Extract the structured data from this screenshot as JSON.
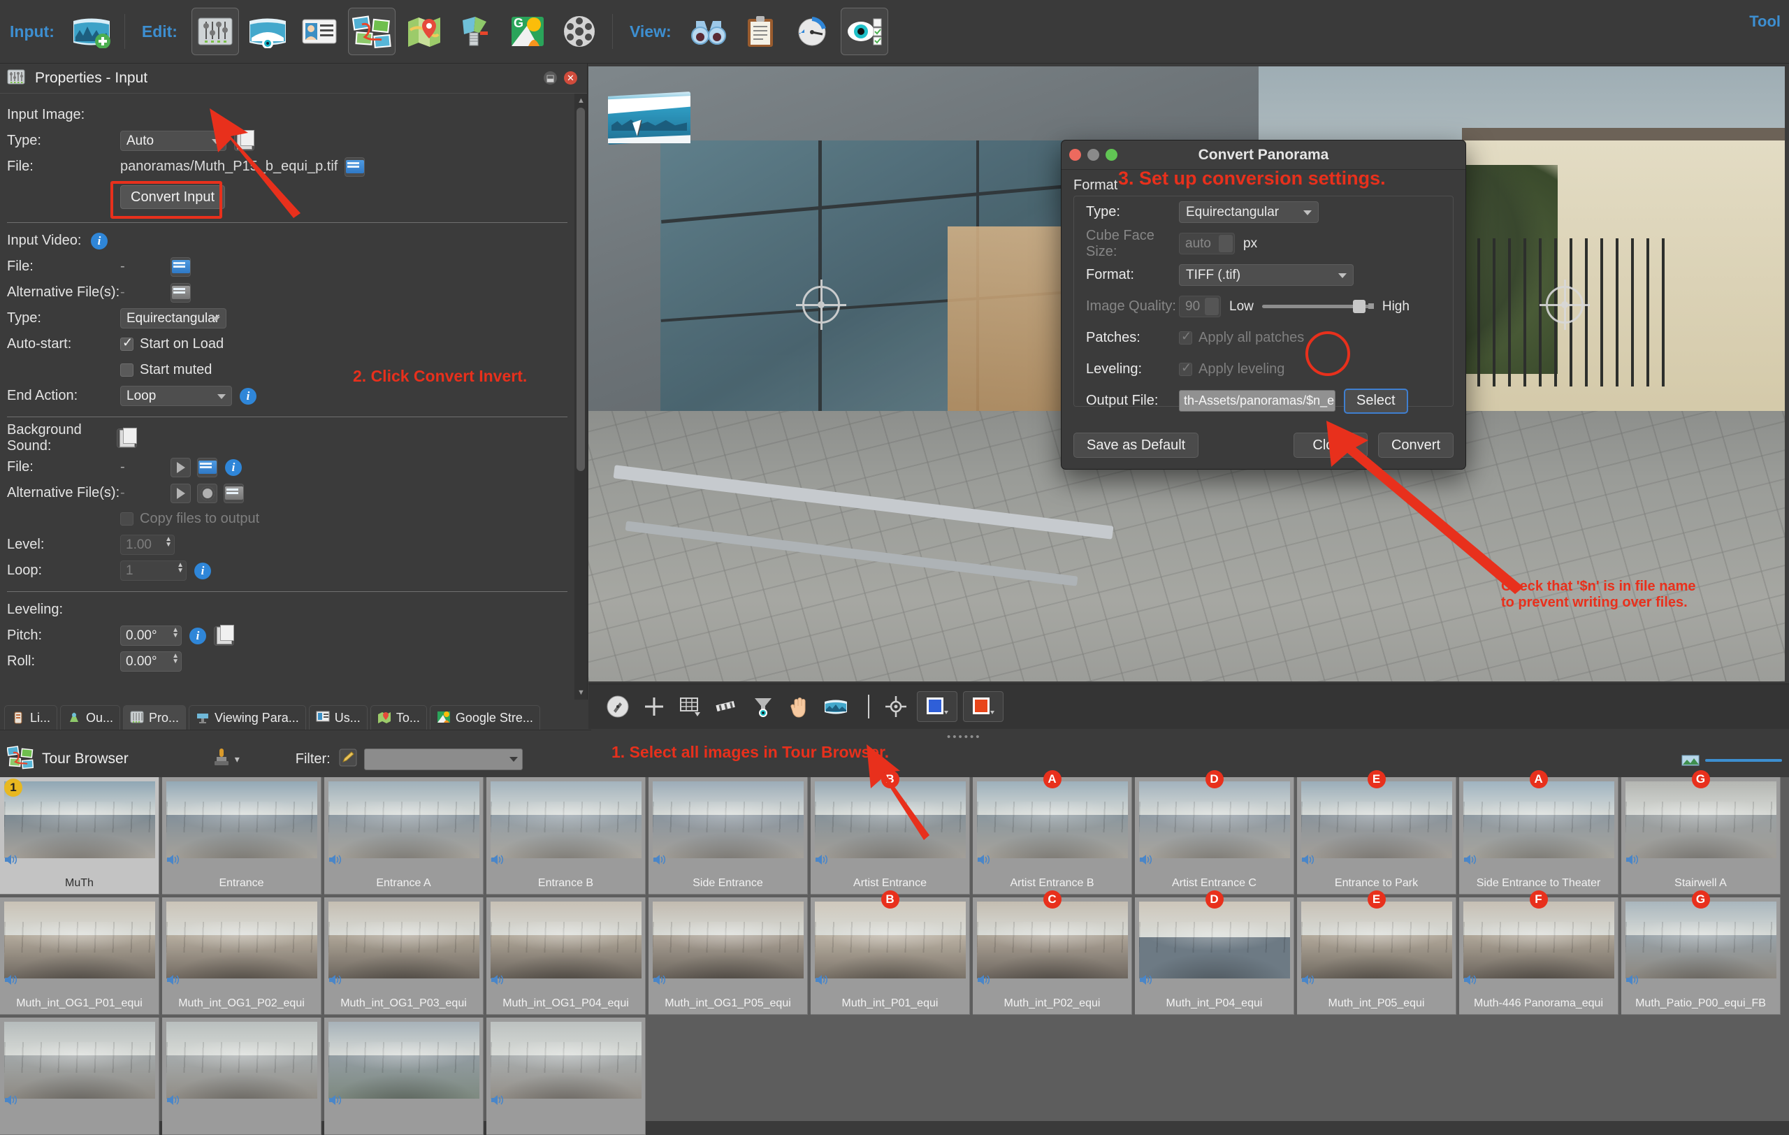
{
  "toolbar": {
    "input_label": "Input:",
    "edit_label": "Edit:",
    "view_label": "View:",
    "tools_label": "Tool",
    "input_items": [
      {
        "name": "add-panorama-icon"
      }
    ],
    "edit_items": [
      {
        "name": "properties-icon"
      },
      {
        "name": "panorama-editor-icon"
      },
      {
        "name": "user-data-icon"
      },
      {
        "name": "tour-editor-icon"
      },
      {
        "name": "map-editor-icon"
      },
      {
        "name": "model-editor-icon"
      },
      {
        "name": "google-street-view-icon"
      },
      {
        "name": "media-icon"
      }
    ],
    "view_items": [
      {
        "name": "binoculars-icon"
      },
      {
        "name": "clipboard-icon"
      },
      {
        "name": "compass-icon"
      },
      {
        "name": "visibility-icon"
      }
    ]
  },
  "properties": {
    "panel_title": "Properties - Input",
    "input_image_header": "Input Image:",
    "type_label": "Type:",
    "type_value": "Auto",
    "file_label": "File:",
    "file_value": "panoramas/Muth_P15_b_equi_p.tif",
    "convert_input_button": "Convert Input",
    "input_video_header": "Input Video:",
    "video_file_label": "File:",
    "video_file_value": "-",
    "video_alt_label": "Alternative File(s):",
    "video_alt_value": "-",
    "video_type_label": "Type:",
    "video_type_value": "Equirectangular",
    "autostart_label": "Auto-start:",
    "start_on_load_label": "Start on Load",
    "start_on_load_checked": true,
    "start_muted_label": "Start muted",
    "start_muted_checked": false,
    "end_action_label": "End Action:",
    "end_action_value": "Loop",
    "bg_sound_header": "Background Sound:",
    "bg_file_label": "File:",
    "bg_file_value": "-",
    "bg_alt_label": "Alternative File(s):",
    "bg_alt_value": "-",
    "copy_files_label": "Copy files to output",
    "copy_files_checked": false,
    "level_label": "Level:",
    "level_value": "1.00",
    "loop_label": "Loop:",
    "loop_value": "1",
    "leveling_header": "Leveling:",
    "pitch_label": "Pitch:",
    "pitch_value": "0.00°",
    "roll_label": "Roll:",
    "roll_value": "0.00°"
  },
  "tabs": [
    {
      "label": "Li...",
      "name": "tab-limits",
      "active": false
    },
    {
      "label": "Ou...",
      "name": "tab-output",
      "active": false
    },
    {
      "label": "Pro...",
      "name": "tab-properties",
      "active": true
    },
    {
      "label": "Viewing Para...",
      "name": "tab-viewing-parameters",
      "active": false
    },
    {
      "label": "Us...",
      "name": "tab-user-data",
      "active": false
    },
    {
      "label": "To...",
      "name": "tab-tour",
      "active": false
    },
    {
      "label": "Google Stre...",
      "name": "tab-google-street-view",
      "active": false
    }
  ],
  "viewer_tools": [
    {
      "name": "compass-icon"
    },
    {
      "name": "crosshair-icon"
    },
    {
      "name": "grid-icon"
    },
    {
      "name": "ruler-icon"
    },
    {
      "name": "filter-icon"
    },
    {
      "name": "hand-icon"
    },
    {
      "name": "panorama-icon"
    },
    {
      "name": "target-icon"
    },
    {
      "name": "blue-color-swatch"
    },
    {
      "name": "orange-color-swatch"
    }
  ],
  "dialog": {
    "title": "Convert Panorama",
    "format_group_label": "Format",
    "type_label": "Type:",
    "type_value": "Equirectangular",
    "cube_face_size_label": "Cube Face Size:",
    "cube_face_size_value": "auto",
    "cube_face_size_unit": "px",
    "format_label": "Format:",
    "format_value": "TIFF (.tif)",
    "image_quality_label": "Image Quality:",
    "image_quality_value": "90",
    "quality_low_label": "Low",
    "quality_high_label": "High",
    "patches_label": "Patches:",
    "apply_all_patches_label": "Apply all patches",
    "apply_all_patches_checked": true,
    "leveling_label": "Leveling:",
    "apply_leveling_label": "Apply leveling",
    "apply_leveling_checked": true,
    "output_file_label": "Output File:",
    "output_file_value": "th-Assets/panoramas/$n_equi.tif",
    "select_button": "Select",
    "save_default_button": "Save as Default",
    "close_button": "Close",
    "convert_button": "Convert"
  },
  "annotations": {
    "step1": "1. Select all images in Tour Browser.",
    "step2": "2. Click Convert Invert.",
    "step3": "3. Set up conversion settings.",
    "step4": "Check that '$n' is in file name\nto prevent writing over files."
  },
  "tour_browser": {
    "title": "Tour Browser",
    "filter_label": "Filter:",
    "filter_value": "",
    "stamp_icon": "stamp-icon",
    "pencil_icon": "pencil-icon",
    "items": [
      {
        "label": "MuTh",
        "badge": "1",
        "badge_color": "yellow",
        "selected": true,
        "sky": "#8fa6b4",
        "ground": "#a9a49c",
        "mid": "#7d8a93"
      },
      {
        "label": "Entrance",
        "badge": "",
        "selected": false,
        "sky": "#93a8b6",
        "ground": "#a6a29a",
        "mid": "#83909a"
      },
      {
        "label": "Entrance A",
        "badge": "",
        "selected": false,
        "sky": "#9fb0ba",
        "ground": "#a8a49c",
        "mid": "#8d99a2"
      },
      {
        "label": "Entrance B",
        "badge": "",
        "selected": false,
        "sky": "#a3b3bd",
        "ground": "#aaa69e",
        "mid": "#919da6"
      },
      {
        "label": "Side Entrance",
        "badge": "",
        "selected": false,
        "sky": "#9cacb8",
        "ground": "#a5a19a",
        "mid": "#8a959f"
      },
      {
        "label": "Artist Entrance",
        "badge": "B",
        "badge_color": "red",
        "selected": false,
        "sky": "#98a9b5",
        "ground": "#a39f98",
        "mid": "#879299"
      },
      {
        "label": "Artist Entrance B",
        "badge": "A",
        "badge_color": "red",
        "selected": false,
        "sky": "#9db0bb",
        "ground": "#a7a39b",
        "mid": "#8b979e"
      },
      {
        "label": "Artist Entrance C",
        "badge": "D",
        "badge_color": "red",
        "selected": false,
        "sky": "#a2b2bd",
        "ground": "#a9a59d",
        "mid": "#8f9aa3"
      },
      {
        "label": "Entrance to Park",
        "badge": "E",
        "badge_color": "red",
        "selected": false,
        "sky": "#9aadb9",
        "ground": "#a49f98",
        "mid": "#8a949c"
      },
      {
        "label": "Side Entrance to Theater",
        "badge": "A",
        "badge_color": "red",
        "selected": false,
        "sky": "#9fb3c0",
        "ground": "#a7a49c",
        "mid": "#8e99a1"
      },
      {
        "label": "Stairwell A",
        "badge": "G",
        "badge_color": "red",
        "selected": false,
        "sky": "#b4b6b2",
        "ground": "#9f9c96",
        "mid": "#9aa0a2"
      }
    ],
    "items_row2": [
      {
        "label": "Muth_int_OG1_P01_equi",
        "badge": "",
        "selected": false,
        "sky": "#c9c2b6",
        "ground": "#6f6860",
        "mid": "#b3aa9c"
      },
      {
        "label": "Muth_int_OG1_P02_equi",
        "badge": "",
        "selected": false,
        "sky": "#cbc4b8",
        "ground": "#736b62",
        "mid": "#b6ad9f"
      },
      {
        "label": "Muth_int_OG1_P03_equi",
        "badge": "",
        "selected": false,
        "sky": "#c5beb2",
        "ground": "#6d665e",
        "mid": "#afa698"
      },
      {
        "label": "Muth_int_OG1_P04_equi",
        "badge": "",
        "selected": false,
        "sky": "#c7c0b5",
        "ground": "#6a635b",
        "mid": "#b1a89a"
      },
      {
        "label": "Muth_int_OG1_P05_equi",
        "badge": "",
        "selected": false,
        "sky": "#c2bbb0",
        "ground": "#6b645c",
        "mid": "#aca397"
      },
      {
        "label": "Muth_int_P01_equi",
        "badge": "B",
        "badge_color": "red",
        "selected": false,
        "sky": "#cfc8bc",
        "ground": "#7a7268",
        "mid": "#bbb2a4"
      },
      {
        "label": "Muth_int_P02_equi",
        "badge": "C",
        "badge_color": "red",
        "selected": false,
        "sky": "#c4bdb1",
        "ground": "#6e675f",
        "mid": "#aea598"
      },
      {
        "label": "Muth_int_P04_equi",
        "badge": "D",
        "badge_color": "red",
        "selected": false,
        "sky": "#cdc6ba",
        "ground": "#767e72",
        "mid": "#b8af a1"
      },
      {
        "label": "Muth_int_P05_equi",
        "badge": "E",
        "badge_color": "red",
        "selected": false,
        "sky": "#c8c1b6",
        "ground": "#716a61",
        "mid": "#b2a99b"
      },
      {
        "label": "Muth-446 Panorama_equi",
        "badge": "F",
        "badge_color": "red",
        "selected": false,
        "sky": "#c6bfb4",
        "ground": "#6c655d",
        "mid": "#b0a799"
      },
      {
        "label": "Muth_Patio_P00_equi_FB",
        "badge": "G",
        "badge_color": "red",
        "selected": false,
        "sky": "#a9b6bd",
        "ground": "#8d8880",
        "mid": "#98a2a8"
      }
    ],
    "items_row3": [
      {
        "label": "",
        "badge": "",
        "selected": false,
        "sky": "#b6bcbc",
        "ground": "#8e8a83",
        "mid": "#a3a8a9"
      },
      {
        "label": "",
        "badge": "",
        "selected": false,
        "sky": "#b9bfbe",
        "ground": "#918d86",
        "mid": "#a6abac"
      },
      {
        "label": "",
        "badge": "",
        "selected": false,
        "sky": "#a7b2b9",
        "ground": "#7e8a80",
        "mid": "#939da3"
      },
      {
        "label": "",
        "badge": "",
        "selected": false,
        "sky": "#bcc1c0",
        "ground": "#948f88",
        "mid": "#a9aeaf"
      }
    ]
  }
}
